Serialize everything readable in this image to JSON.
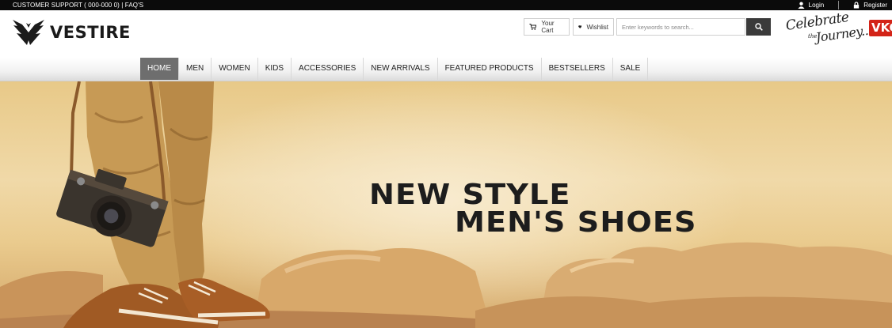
{
  "topbar": {
    "support_text": "CUSTOMER SUPPORT ( 000-000 0) |",
    "faq_label": "FAQ'S",
    "login_label": "Login",
    "register_label": "Register",
    "login_icon": "user-icon",
    "register_icon": "lock-icon"
  },
  "header": {
    "logo_text": "VESTIRE",
    "cart_label": "Your Cart",
    "wishlist_label": "Wishlist",
    "search_placeholder": "Enter keywords to search...",
    "celebrate_line1": "Celebrate",
    "celebrate_line2": "the",
    "celebrate_line3": "Journey...",
    "partner_badge": "VKC"
  },
  "nav": {
    "items": [
      {
        "label": "HOME",
        "active": true
      },
      {
        "label": "MEN"
      },
      {
        "label": "WOMEN"
      },
      {
        "label": "KIDS"
      },
      {
        "label": "ACCESSORIES"
      },
      {
        "label": "NEW ARRIVALS"
      },
      {
        "label": "FEATURED PRODUCTS"
      },
      {
        "label": "BESTSELLERS"
      },
      {
        "label": "SALE"
      }
    ]
  },
  "hero": {
    "headline_line1": "NEW STYLE",
    "headline_line2": "MEN'S SHOES"
  },
  "colors": {
    "topbar_bg": "#0b0b0b",
    "nav_active_bg": "#6e6e6e",
    "search_button_bg": "#3a3a3a",
    "badge_red": "#d32418",
    "hero_sand": "#e8c988"
  }
}
